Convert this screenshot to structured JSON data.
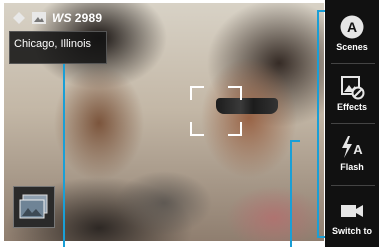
{
  "status": {
    "size_prefix": "WS",
    "size_value": "2989"
  },
  "location": {
    "label": "Chicago, Illinois"
  },
  "controls": [
    {
      "label": "Scenes",
      "icon": "scenes-a-icon"
    },
    {
      "label": "Effects",
      "icon": "effects-icon"
    },
    {
      "label": "Flash",
      "icon": "flash-auto-icon"
    },
    {
      "label": "Switch to",
      "icon": "video-camera-icon"
    }
  ],
  "colors": {
    "callout": "#1a9fd6",
    "control_bar": "#111111"
  }
}
